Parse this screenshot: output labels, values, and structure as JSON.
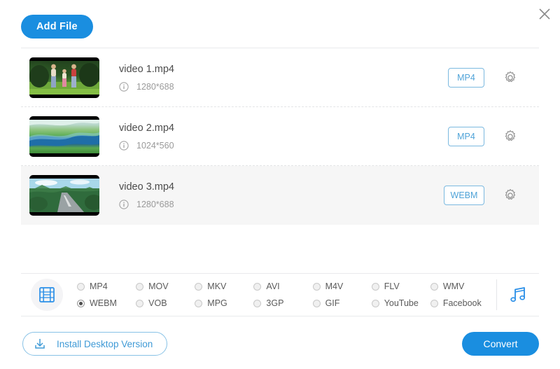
{
  "window": {
    "close_label": "×",
    "accent_blue": "#1a8ee0",
    "badge_blue": "#4fa3d8",
    "selected_row_bg": "#f6f6f6"
  },
  "toolbar": {
    "add_file_label": "Add File"
  },
  "files": [
    {
      "name": "video 1.mp4",
      "resolution": "1280*688",
      "format": "MP4",
      "selected": false,
      "thumb": "family-garden-thumbnail"
    },
    {
      "name": "video 2.mp4",
      "resolution": "1024*560",
      "format": "MP4",
      "selected": false,
      "thumb": "river-field-thumbnail"
    },
    {
      "name": "video 3.mp4",
      "resolution": "1280*688",
      "format": "WEBM",
      "selected": true,
      "thumb": "mountain-road-thumbnail"
    }
  ],
  "format_panel": {
    "video_icon": "film-strip-icon",
    "audio_icon": "music-note-icon",
    "selected": "WEBM",
    "options": [
      "MP4",
      "MOV",
      "MKV",
      "AVI",
      "M4V",
      "FLV",
      "WMV",
      "WEBM",
      "VOB",
      "MPG",
      "3GP",
      "GIF",
      "YouTube",
      "Facebook"
    ]
  },
  "footer": {
    "install_label": "Install Desktop Version",
    "install_icon": "download-icon",
    "convert_label": "Convert"
  }
}
